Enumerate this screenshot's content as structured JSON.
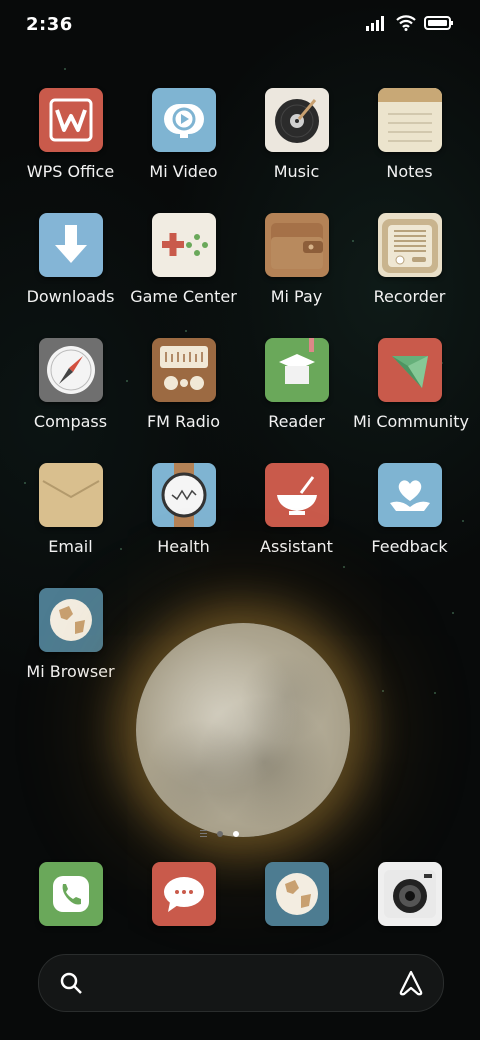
{
  "status_bar": {
    "time": "2:36",
    "icons": [
      "signal-icon",
      "wifi-icon",
      "battery-icon"
    ]
  },
  "apps": [
    {
      "label": "WPS Office",
      "icon": "wps-office-icon",
      "color": "#c95a4b"
    },
    {
      "label": "Mi Video",
      "icon": "mi-video-icon",
      "color": "#7fb4d2"
    },
    {
      "label": "Music",
      "icon": "music-icon",
      "color": "#ece7de"
    },
    {
      "label": "Notes",
      "icon": "notes-icon",
      "color": "#ece4cd"
    },
    {
      "label": "Downloads",
      "icon": "downloads-icon",
      "color": "#84b5d6"
    },
    {
      "label": "Game Center",
      "icon": "game-center-icon",
      "color": "#f1ece2"
    },
    {
      "label": "Mi Pay",
      "icon": "mi-pay-icon",
      "color": "#b48256"
    },
    {
      "label": "Recorder",
      "icon": "recorder-icon",
      "color": "#e9dfc8"
    },
    {
      "label": "Compass",
      "icon": "compass-icon",
      "color": "#6f6f6f"
    },
    {
      "label": "FM Radio",
      "icon": "fm-radio-icon",
      "color": "#9c6a42"
    },
    {
      "label": "Reader",
      "icon": "reader-icon",
      "color": "#6aa85a"
    },
    {
      "label": "Mi Community",
      "icon": "mi-community-icon",
      "color": "#c95a4b"
    },
    {
      "label": "Email",
      "icon": "email-icon",
      "color": "#d9bf8e"
    },
    {
      "label": "Health",
      "icon": "health-icon",
      "color": "#7fb4d2"
    },
    {
      "label": "Assistant",
      "icon": "assistant-icon",
      "color": "#c95a4b"
    },
    {
      "label": "Feedback",
      "icon": "feedback-icon",
      "color": "#7fb4d2"
    },
    {
      "label": "Mi Browser",
      "icon": "mi-browser-icon",
      "color": "#4d7c91"
    }
  ],
  "pager": {
    "pages": 2,
    "active_index": 1
  },
  "dock": [
    {
      "icon": "phone-icon",
      "color": "#6aa85a"
    },
    {
      "icon": "messages-icon",
      "color": "#c95a4b"
    },
    {
      "icon": "browser-icon",
      "color": "#4d7c91"
    },
    {
      "icon": "camera-icon",
      "color": "#efefef"
    }
  ],
  "search_bar": {
    "left_icon": "search-icon",
    "right_icon": "assistant-a-icon"
  }
}
